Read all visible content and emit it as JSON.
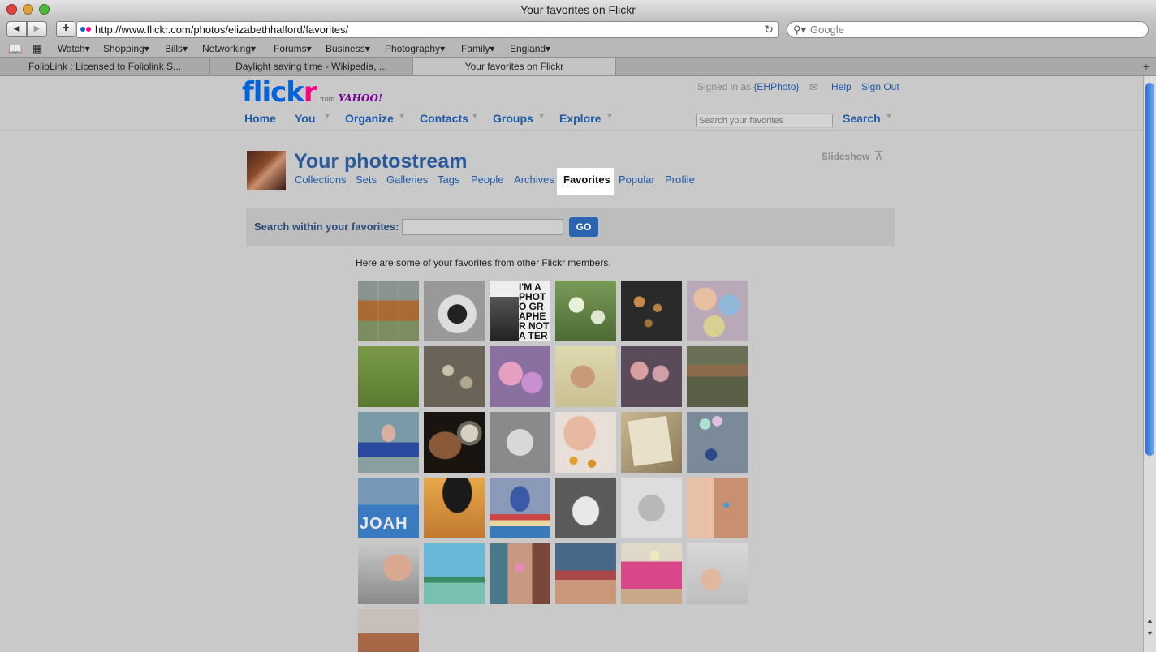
{
  "window": {
    "title": "Your favorites on Flickr"
  },
  "toolbar": {
    "url": "http://www.flickr.com/photos/elizabethhalford/favorites/",
    "search_placeholder": "Google"
  },
  "bookmarks": [
    "Watch",
    "Shopping",
    "Bills",
    "Networking",
    "Forums",
    "Business",
    "Photography",
    "Family",
    "England"
  ],
  "tabs": [
    {
      "label": "FolioLink : Licensed to Foliolink S..."
    },
    {
      "label": "Daylight saving time - Wikipedia, ..."
    },
    {
      "label": "Your favorites on Flickr"
    }
  ],
  "flickr": {
    "logo_text": "flickr",
    "from_text": "from",
    "yahoo_text": "YAHOO!",
    "signed_in_prefix": "Signed in as",
    "username": "{EHPhoto}",
    "help": "Help",
    "sign_out": "Sign Out",
    "nav": [
      "Home",
      "You",
      "Organize",
      "Contacts",
      "Groups",
      "Explore"
    ],
    "search_placeholder": "Search your favorites",
    "search_button": "Search"
  },
  "photostream": {
    "title": "Your photostream",
    "slideshow": "Slideshow",
    "nav": [
      "Collections",
      "Sets",
      "Galleries",
      "Tags",
      "People",
      "Archives",
      "Favorites",
      "Popular",
      "Profile"
    ],
    "active": "Favorites"
  },
  "fav_search": {
    "label": "Search within your favorites:",
    "button": "GO",
    "value": ""
  },
  "intro_text": "Here are some of your favorites from other Flickr members.",
  "photos": [
    {
      "id": 1
    },
    {
      "id": 2
    },
    {
      "id": 3
    },
    {
      "id": 4
    },
    {
      "id": 5
    },
    {
      "id": 6
    },
    {
      "id": 7
    },
    {
      "id": 8
    },
    {
      "id": 9
    },
    {
      "id": 10
    },
    {
      "id": 11
    },
    {
      "id": 12
    },
    {
      "id": 13
    },
    {
      "id": 14
    },
    {
      "id": 15
    },
    {
      "id": 16
    },
    {
      "id": 17
    },
    {
      "id": 18
    },
    {
      "id": 19
    },
    {
      "id": 20
    },
    {
      "id": 21
    },
    {
      "id": 22
    },
    {
      "id": 23
    },
    {
      "id": 24
    },
    {
      "id": 25
    },
    {
      "id": 26
    },
    {
      "id": 27
    },
    {
      "id": 28
    },
    {
      "id": 29
    },
    {
      "id": 30
    },
    {
      "id": 31
    }
  ],
  "photo_text": {
    "im_photographer": "I'M A PHOTO GRAPHER NOT A TERRO IST",
    "blocks": "JOAH"
  },
  "colors": {
    "flickr_blue": "#0063dc",
    "flickr_pink": "#ff0084",
    "yahoo_purple": "#7b0099",
    "link_blue": "#1f5ba8",
    "go_button": "#2a64b0"
  }
}
